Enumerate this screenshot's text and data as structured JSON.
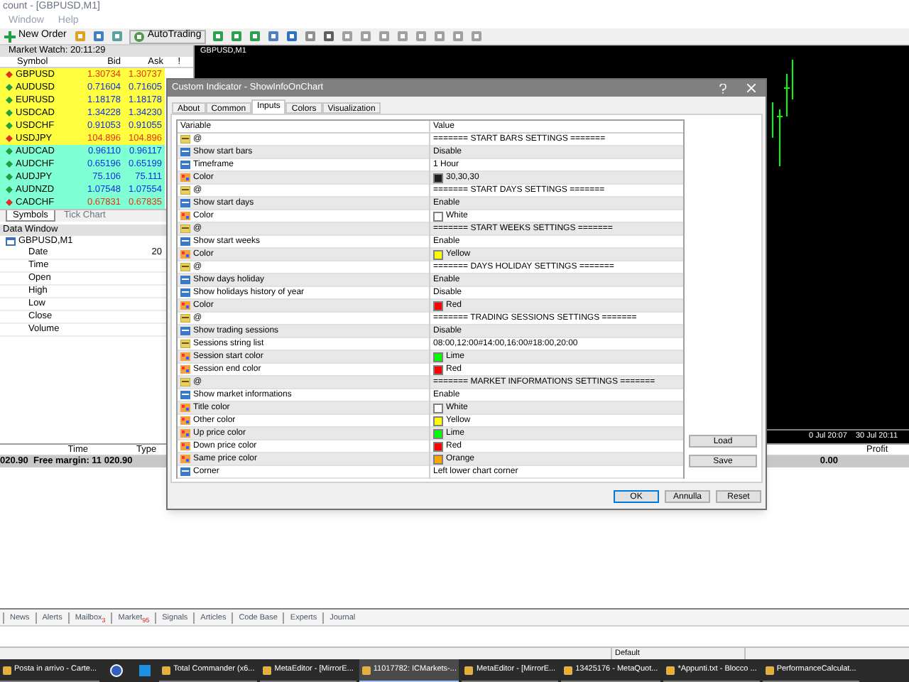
{
  "window": {
    "title": "count - [GBPUSD,M1]"
  },
  "menu": [
    "Window",
    "Help"
  ],
  "toolbar": {
    "new_order": "New Order",
    "autotrading": "AutoTrading"
  },
  "market_watch": {
    "title": "Market Watch: 20:11:29",
    "columns": [
      "Symbol",
      "Bid",
      "Ask",
      "!"
    ],
    "rows": [
      {
        "symbol": "GBPUSD",
        "bid": "1.30734",
        "ask": "1.30737",
        "falling": true,
        "color": "#ffff40"
      },
      {
        "symbol": "AUDUSD",
        "bid": "0.71604",
        "ask": "0.71605",
        "falling": false,
        "color": "#ffff40"
      },
      {
        "symbol": "EURUSD",
        "bid": "1.18178",
        "ask": "1.18178",
        "falling": false,
        "color": "#ffff40"
      },
      {
        "symbol": "USDCAD",
        "bid": "1.34228",
        "ask": "1.34230",
        "falling": false,
        "color": "#ffff40"
      },
      {
        "symbol": "USDCHF",
        "bid": "0.91053",
        "ask": "0.91055",
        "falling": false,
        "color": "#ffff40"
      },
      {
        "symbol": "USDJPY",
        "bid": "104.896",
        "ask": "104.896",
        "falling": true,
        "color": "#ffff40"
      },
      {
        "symbol": "AUDCAD",
        "bid": "0.96110",
        "ask": "0.96117",
        "falling": false,
        "color": "#7fffd4"
      },
      {
        "symbol": "AUDCHF",
        "bid": "0.65196",
        "ask": "0.65199",
        "falling": false,
        "color": "#7fffd4"
      },
      {
        "symbol": "AUDJPY",
        "bid": "75.106",
        "ask": "75.111",
        "falling": false,
        "color": "#7fffd4"
      },
      {
        "symbol": "AUDNZD",
        "bid": "1.07548",
        "ask": "1.07554",
        "falling": false,
        "color": "#7fffd4"
      },
      {
        "symbol": "CADCHF",
        "bid": "0.67831",
        "ask": "0.67835",
        "falling": true,
        "color": "#7fffd4"
      }
    ],
    "tabs": [
      {
        "label": "Symbols",
        "selected": true
      },
      {
        "label": "Tick Chart",
        "selected": false
      }
    ]
  },
  "data_window": {
    "title": "Data Window",
    "symbol": "GBPUSD,M1",
    "rows": [
      {
        "label": "Date",
        "value": "20"
      },
      {
        "label": "Time"
      },
      {
        "label": "Open"
      },
      {
        "label": "High"
      },
      {
        "label": "Low"
      },
      {
        "label": "Close"
      },
      {
        "label": "Volume"
      }
    ]
  },
  "chart": {
    "tab": "GBPUSD,M1",
    "time_labels": [
      "0 Jul 20:07",
      "30 Jul 20:11"
    ]
  },
  "dialog": {
    "title": "Custom Indicator - ShowInfoOnChart",
    "tabs": [
      {
        "label": "About",
        "selected": false
      },
      {
        "label": "Common",
        "selected": false
      },
      {
        "label": "Inputs",
        "selected": true
      },
      {
        "label": "Colors",
        "selected": false
      },
      {
        "label": "Visualization",
        "selected": false
      }
    ],
    "columns": [
      "Variable",
      "Value"
    ],
    "rows": [
      {
        "kind": "string",
        "variable": "@",
        "value": "======= START BARS SETTINGS ======="
      },
      {
        "kind": "enum",
        "variable": "Show start bars",
        "value": "Disable"
      },
      {
        "kind": "enum",
        "variable": "Timeframe",
        "value": "1 Hour"
      },
      {
        "kind": "color",
        "variable": "Color",
        "value": "30,30,30",
        "color": "#1e1e1e"
      },
      {
        "kind": "string",
        "variable": "@",
        "value": "======= START DAYS SETTINGS ======="
      },
      {
        "kind": "enum",
        "variable": "Show start days",
        "value": "Enable"
      },
      {
        "kind": "color",
        "variable": "Color",
        "value": "White",
        "color": "#ffffff"
      },
      {
        "kind": "string",
        "variable": "@",
        "value": "======= START WEEKS SETTINGS ======="
      },
      {
        "kind": "enum",
        "variable": "Show start weeks",
        "value": "Enable"
      },
      {
        "kind": "color",
        "variable": "Color",
        "value": "Yellow",
        "color": "#ffff00"
      },
      {
        "kind": "string",
        "variable": "@",
        "value": "======= DAYS HOLIDAY SETTINGS ======="
      },
      {
        "kind": "enum",
        "variable": "Show days holiday",
        "value": "Enable"
      },
      {
        "kind": "enum",
        "variable": "Show holidays history of year",
        "value": "Disable"
      },
      {
        "kind": "color",
        "variable": "Color",
        "value": "Red",
        "color": "#ff0000"
      },
      {
        "kind": "string",
        "variable": "@",
        "value": "======= TRADING SESSIONS SETTINGS ======="
      },
      {
        "kind": "enum",
        "variable": "Show trading sessions",
        "value": "Disable"
      },
      {
        "kind": "string",
        "variable": "Sessions string list",
        "value": "08:00,12:00#14:00,16:00#18:00,20:00"
      },
      {
        "kind": "color",
        "variable": "Session start color",
        "value": "Lime",
        "color": "#00ff00"
      },
      {
        "kind": "color",
        "variable": "Session end color",
        "value": "Red",
        "color": "#ff0000"
      },
      {
        "kind": "string",
        "variable": "@",
        "value": "======= MARKET INFORMATIONS SETTINGS ======="
      },
      {
        "kind": "enum",
        "variable": "Show market informations",
        "value": "Enable"
      },
      {
        "kind": "color",
        "variable": "Title color",
        "value": "White",
        "color": "#ffffff"
      },
      {
        "kind": "color",
        "variable": "Other color",
        "value": "Yellow",
        "color": "#ffff00"
      },
      {
        "kind": "color",
        "variable": "Up price color",
        "value": "Lime",
        "color": "#00ff00"
      },
      {
        "kind": "color",
        "variable": "Down price color",
        "value": "Red",
        "color": "#ff0000"
      },
      {
        "kind": "color",
        "variable": "Same price color",
        "value": "Orange",
        "color": "#ffa500"
      },
      {
        "kind": "enum",
        "variable": "Corner",
        "value": "Left lower chart corner"
      }
    ],
    "side_buttons": [
      "Load",
      "Save"
    ],
    "buttons": [
      "OK",
      "Annulla",
      "Reset"
    ]
  },
  "terminal": {
    "columns": [
      "Time",
      "Type",
      "Profit"
    ],
    "summary": "020.90  Free margin: 11 020.90",
    "profit": "0.00"
  },
  "terminal_tabs": [
    {
      "label": "News"
    },
    {
      "label": "Alerts"
    },
    {
      "label": "Mailbox",
      "badge": "3"
    },
    {
      "label": "Market",
      "badge": "95"
    },
    {
      "label": "Signals"
    },
    {
      "label": "Articles"
    },
    {
      "label": "Code Base"
    },
    {
      "label": "Experts"
    },
    {
      "label": "Journal"
    }
  ],
  "status_bar": {
    "profile": "Default"
  },
  "taskbar": [
    {
      "label": "Posta in arrivo - Carte...",
      "selected": false
    },
    {
      "label": "Total Commander (x6...",
      "selected": false
    },
    {
      "label": "MetaEditor - [MirrorE...",
      "selected": false
    },
    {
      "label": "11017782: ICMarkets-...",
      "selected": true
    },
    {
      "label": "MetaEditor - [MirrorE...",
      "selected": false
    },
    {
      "label": "13425176 - MetaQuot...",
      "selected": false
    },
    {
      "label": "*Appunti.txt - Blocco ...",
      "selected": false
    },
    {
      "label": "PerformanceCalculat...",
      "selected": false
    }
  ]
}
